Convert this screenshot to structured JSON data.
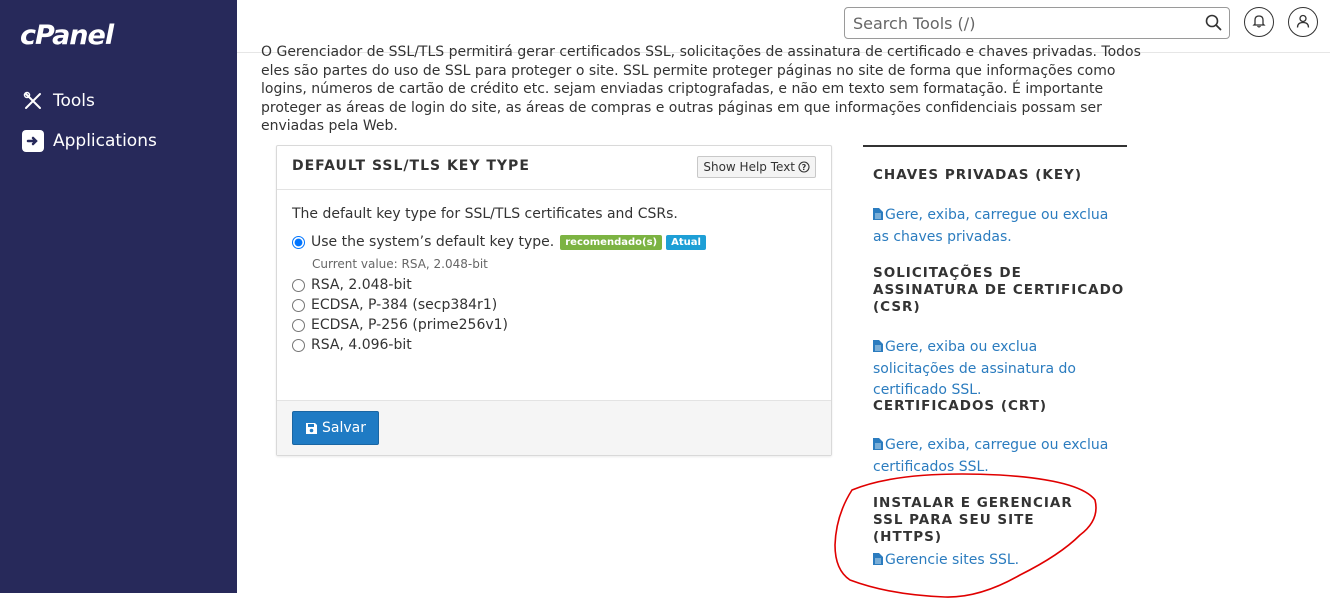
{
  "sidebar": {
    "logo": "cPanel",
    "items": [
      {
        "label": "Tools",
        "icon": "tools-icon"
      },
      {
        "label": "Applications",
        "icon": "applications-icon"
      }
    ]
  },
  "header": {
    "search_placeholder": "Search Tools (/)",
    "bell_icon": "bell-icon",
    "user_icon": "user-icon"
  },
  "intro": {
    "text": "O Gerenciador de SSL/TLS permitirá gerar certificados SSL, solicitações de assinatura de certificado e chaves privadas. Todos eles são partes do uso de SSL para proteger o site. SSL permite proteger páginas no site de forma que informações como logins, números de cartão de crédito etc. sejam enviadas criptografadas, e não em texto sem formatação. É importante proteger as áreas de login do site, as áreas de compras e outras páginas em que informações confidenciais possam ser enviadas pela Web."
  },
  "panel": {
    "title": "DEFAULT SSL/TLS KEY TYPE",
    "help_button": "Show Help Text",
    "description": "The default key type for SSL/TLS certificates and CSRs.",
    "options": [
      {
        "label": "Use the system’s default key type.",
        "selected": true
      },
      {
        "label": "RSA, 2.048-bit",
        "selected": false
      },
      {
        "label": "ECDSA, P-384 (secp384r1)",
        "selected": false
      },
      {
        "label": "ECDSA, P-256 (prime256v1)",
        "selected": false
      },
      {
        "label": "RSA, 4.096-bit",
        "selected": false
      }
    ],
    "badges": {
      "recommended": "recomendado(s)",
      "current": "Atual"
    },
    "current_value": "Current value: RSA, 2.048-bit",
    "save_button": "Salvar"
  },
  "right": {
    "sections": [
      {
        "title": "CHAVES PRIVADAS (KEY)",
        "link": "Gere, exiba, carregue ou exclua as chaves privadas."
      },
      {
        "title": "SOLICITAÇÕES DE ASSINATURA DE CERTIFICADO (CSR)",
        "link": "Gere, exiba ou exclua solicitações de assinatura do certificado SSL."
      },
      {
        "title": "CERTIFICADOS (CRT)",
        "link": "Gere, exiba, carregue ou exclua certificados SSL."
      },
      {
        "title": "INSTALAR E GERENCIAR SSL PARA SEU SITE (HTTPS)",
        "link": "Gerencie sites SSL."
      }
    ]
  },
  "colors": {
    "sidebar": "#27295a",
    "link": "#2b7cbf",
    "badge_recommended": "#7cb342",
    "badge_current": "#1e9fd6",
    "save_button": "#1f7bc4",
    "annotation": "#e00000"
  }
}
